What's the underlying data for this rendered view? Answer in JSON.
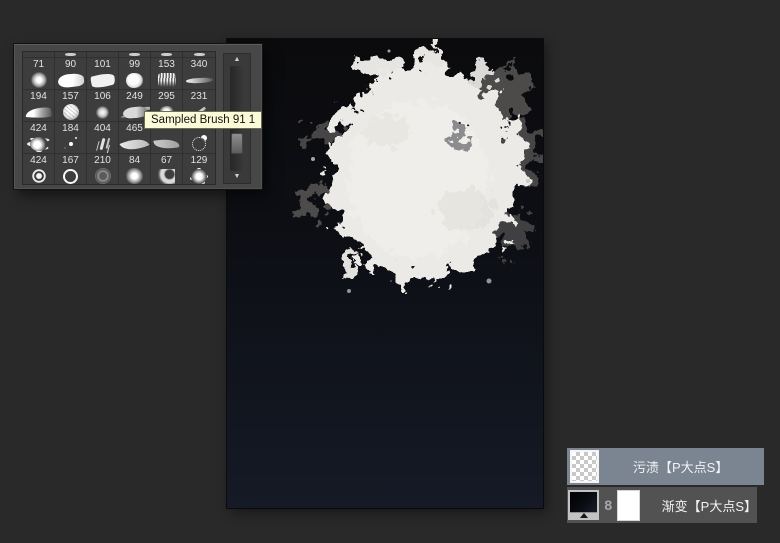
{
  "colors": {
    "workspace_bg": "#292929",
    "panel_bg": "#474747",
    "panel_grid_bg": "#3d3d3d",
    "cell_border": "#303030",
    "number_text": "#e2e2e2",
    "tooltip_bg": "#fbfbd7",
    "tooltip_border": "#6e6e57",
    "tooltip_text": "#111111",
    "canvas_top": "#0b0b0d",
    "canvas_bottom": "#151a26",
    "splat": "#eceae6",
    "selected_layer_bg": "#7a8591",
    "layer_bg": "#525252",
    "layer_text": "#f2f2f2"
  },
  "brush_panel": {
    "tooltip": "Sampled Brush 91 1",
    "scroll_up": "▲",
    "scroll_down": "▼",
    "tips": [
      false,
      true,
      false,
      true,
      true,
      true
    ],
    "bands": [
      {
        "numbers": [
          "71",
          "90",
          "101",
          "99",
          "153",
          "340"
        ],
        "thumbs": [
          "soft-round-glow",
          "wide-smear",
          "leaf-smear",
          "rough-blob",
          "streak-cluster",
          "thin-streak"
        ]
      },
      {
        "numbers": [
          "194",
          "157",
          "106",
          "249",
          "295",
          "231"
        ],
        "thumbs": [
          "swoosh-horn",
          "scribble-ball",
          "mottled-blob",
          "scratch-smudge",
          "hidden-splat",
          "pen-diagonal"
        ]
      },
      {
        "numbers": [
          "424",
          "184",
          "404",
          "465",
          "",
          ""
        ],
        "thumbs": [
          "burst-splat",
          "spray-specks",
          "splatter-drops",
          "leaf-large",
          "leaf-soft",
          "dot-ring"
        ]
      },
      {
        "numbers": [
          "424",
          "167",
          "210",
          "84",
          "67",
          "129"
        ],
        "thumbs": [
          "donut-dot",
          "bold-ring",
          "swirl-faint",
          "fuzzy-blob",
          "crescent-fuzzy",
          "spiky-blob"
        ]
      }
    ]
  },
  "canvas": {
    "content": "white-paint-splat-on-dark-gradient"
  },
  "layers": {
    "items": [
      {
        "name": "污渍【P大点S】",
        "selected": true,
        "thumb": "transparent-checker"
      },
      {
        "name": "渐变【P大点S】",
        "selected": false,
        "thumb": "gradient-preview",
        "link": "8",
        "mask": "white-mask"
      }
    ]
  }
}
